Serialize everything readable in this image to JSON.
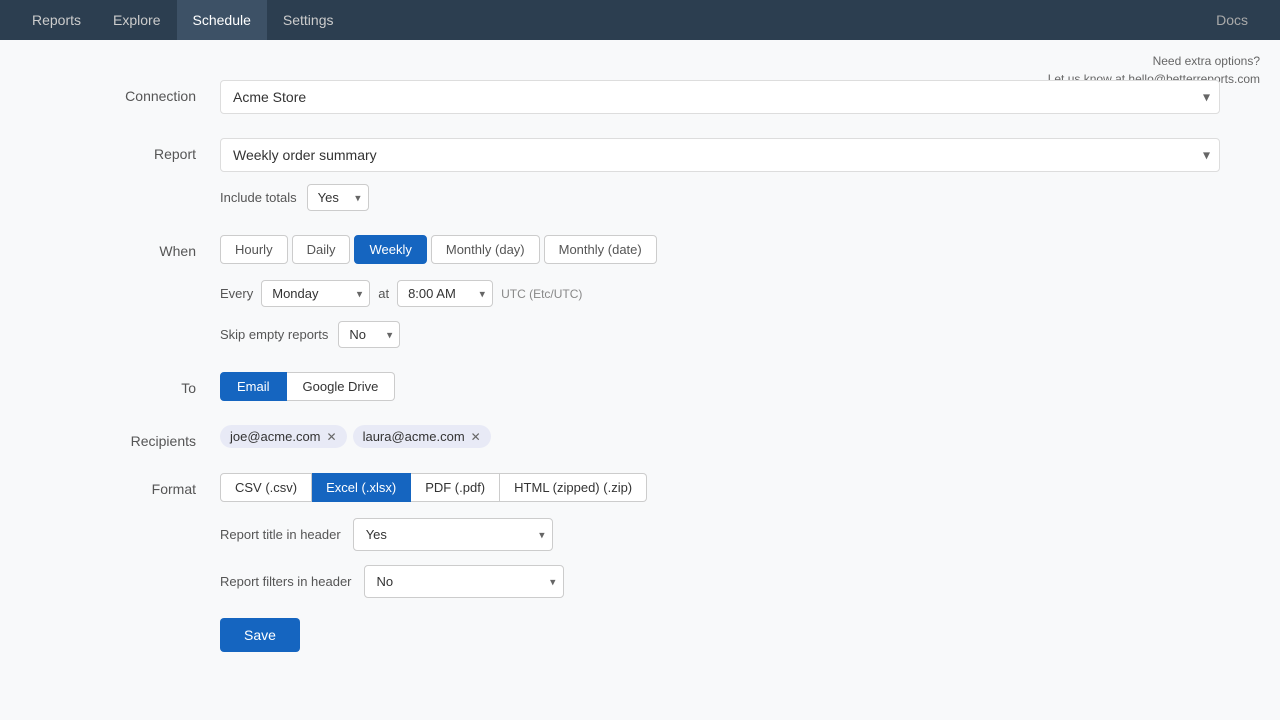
{
  "nav": {
    "items": [
      {
        "label": "Reports",
        "active": false
      },
      {
        "label": "Explore",
        "active": false
      },
      {
        "label": "Schedule",
        "active": true
      },
      {
        "label": "Settings",
        "active": false
      }
    ],
    "docs_label": "Docs"
  },
  "help": {
    "line1": "Need extra options?",
    "line2": "Let us know at hello@betterreports.com"
  },
  "form": {
    "connection_label": "Connection",
    "connection_value": "Acme Store",
    "report_label": "Report",
    "report_value": "Weekly order summary",
    "include_totals_label": "Include totals",
    "include_totals_value": "Yes",
    "when_label": "When",
    "when_tabs": [
      {
        "label": "Hourly",
        "active": false
      },
      {
        "label": "Daily",
        "active": false
      },
      {
        "label": "Weekly",
        "active": true
      },
      {
        "label": "Monthly (day)",
        "active": false
      },
      {
        "label": "Monthly (date)",
        "active": false
      }
    ],
    "every_label": "Every",
    "every_value": "Monday",
    "at_label": "at",
    "time_value": "8:00 AM",
    "timezone_label": "UTC (Etc/UTC)",
    "skip_label": "Skip empty reports",
    "skip_value": "No",
    "to_label": "To",
    "to_tabs": [
      {
        "label": "Email",
        "active": true
      },
      {
        "label": "Google Drive",
        "active": false
      }
    ],
    "recipients_label": "Recipients",
    "recipients": [
      {
        "email": "joe@acme.com"
      },
      {
        "email": "laura@acme.com"
      }
    ],
    "format_label": "Format",
    "format_tabs": [
      {
        "label": "CSV (.csv)",
        "active": false
      },
      {
        "label": "Excel (.xlsx)",
        "active": true
      },
      {
        "label": "PDF (.pdf)",
        "active": false
      },
      {
        "label": "HTML (zipped) (.zip)",
        "active": false
      }
    ],
    "report_title_label": "Report title in header",
    "report_title_value": "Yes",
    "report_filters_label": "Report filters in header",
    "report_filters_value": "No",
    "save_label": "Save"
  }
}
